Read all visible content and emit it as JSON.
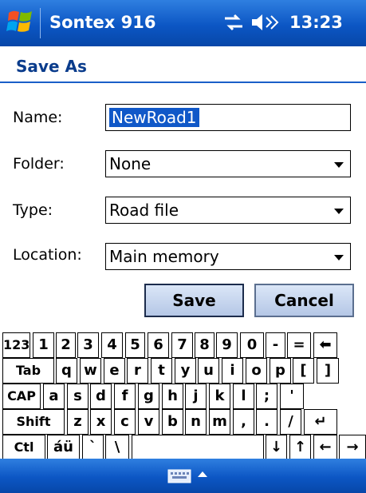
{
  "titlebar": {
    "app_title": "Sontex 916",
    "time": "13:23"
  },
  "page": {
    "title": "Save As"
  },
  "form": {
    "name_label": "Name:",
    "name_value": "NewRoad1",
    "folder_label": "Folder:",
    "folder_value": "None",
    "type_label": "Type:",
    "type_value": "Road file",
    "location_label": "Location:",
    "location_value": "Main memory"
  },
  "buttons": {
    "save": "Save",
    "cancel": "Cancel"
  },
  "keyboard": {
    "rows": [
      [
        "123",
        "1",
        "2",
        "3",
        "4",
        "5",
        "6",
        "7",
        "8",
        "9",
        "0",
        "-",
        "=",
        "⬅"
      ],
      [
        "Tab",
        "q",
        "w",
        "e",
        "r",
        "t",
        "y",
        "u",
        "i",
        "o",
        "p",
        "[",
        "]"
      ],
      [
        "CAP",
        "a",
        "s",
        "d",
        "f",
        "g",
        "h",
        "j",
        "k",
        "l",
        ";",
        "'"
      ],
      [
        "Shift",
        "z",
        "x",
        "c",
        "v",
        "b",
        "n",
        "m",
        ",",
        ".",
        "/",
        "↵"
      ],
      [
        "Ctl",
        "áü",
        "`",
        "\\",
        "",
        "↓",
        "↑",
        "←",
        "→"
      ]
    ]
  },
  "icons": {
    "start": "windows-flag-icon",
    "connectivity": "connectivity-icon",
    "volume": "speaker-icon",
    "input": "keyboard-icon"
  }
}
